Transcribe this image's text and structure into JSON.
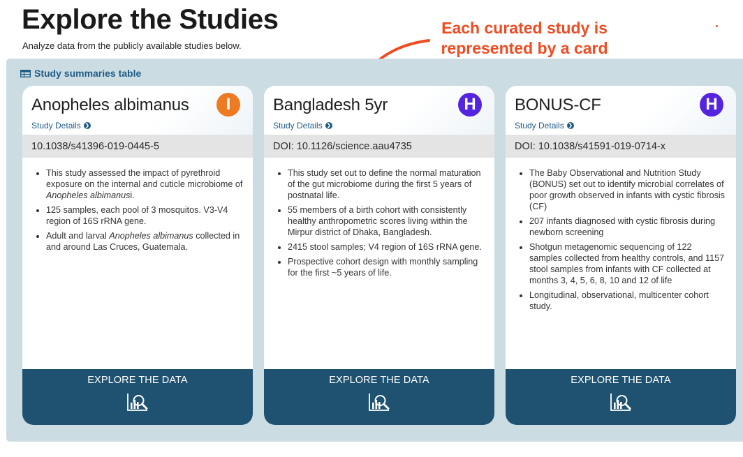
{
  "header": {
    "title": "Explore the Studies",
    "subtitle": "Analyze data from the publicly available studies below."
  },
  "annotation": {
    "line1": "Each curated study is",
    "line2": "represented by a card",
    "color": "#ee4c22"
  },
  "table_link": {
    "label": "Study summaries table",
    "icon": "table-icon"
  },
  "colors": {
    "panel_bg": "#cbdde3",
    "footer_bg": "#1f5270",
    "link": "#225d86",
    "badge_orange": "#ee7a22",
    "badge_purple": "#5524e0"
  },
  "cards": [
    {
      "title": "Anopheles albimanus",
      "badge": "I",
      "badge_color": "#ee7a22",
      "details_label": "Study Details",
      "doi": "10.1038/s41396-019-0445-5",
      "bullets": [
        [
          "This study assessed the impact of pyrethroid exposure on the internal and cuticle microbiome of ",
          "Anopheles albimanus",
          "i."
        ],
        [
          "125 samples, each pool of 3 mosquitos. V3-V4 region of 16S rRNA gene."
        ],
        [
          "Adult and larval ",
          "Anopheles albimanus",
          " collected in and around Las Cruces, Guatemala."
        ]
      ],
      "explore_label": "EXPLORE THE DATA"
    },
    {
      "title": "Bangladesh 5yr",
      "badge": "H",
      "badge_color": "#5524e0",
      "details_label": "Study Details",
      "doi": "DOI: 10.1126/science.aau4735",
      "bullets": [
        [
          "This study set out to define the normal maturation of the gut microbiome during the first 5 years of postnatal life."
        ],
        [
          "55 members of a birth cohort with consistently healthy anthropometric scores living within the Mirpur district of Dhaka, Bangladesh."
        ],
        [
          "2415 stool samples; V4 region of 16S rRNA gene."
        ],
        [
          "Prospective cohort design with monthly sampling for the first ~5 years of life."
        ]
      ],
      "explore_label": "EXPLORE THE DATA"
    },
    {
      "title": "BONUS-CF",
      "badge": "H",
      "badge_color": "#5524e0",
      "details_label": "Study Details",
      "doi": "DOI: 10.1038/s41591-019-0714-x",
      "bullets": [
        [
          "The Baby Observational and Nutrition Study (BONUS) set out to identify microbial correlates of poor growth observed in infants with cystic fibrosis (CF)"
        ],
        [
          "207 infants diagnosed with cystic fibrosis during newborn screening"
        ],
        [
          "Shotgun metagenomic sequencing of 122 samples collected from healthy controls, and 1157 stool samples from infants with CF collected at months 3, 4, 5, 6, 8, 10 and 12 of life"
        ],
        [
          "Longitudinal, observational, multicenter cohort study."
        ]
      ],
      "explore_label": "EXPLORE THE DATA"
    }
  ]
}
